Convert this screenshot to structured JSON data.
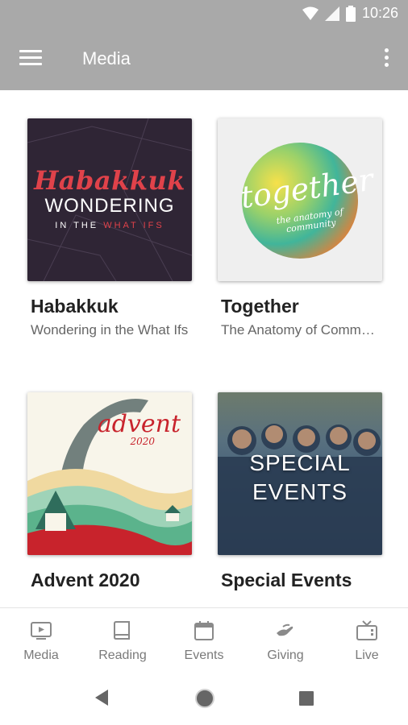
{
  "status_bar": {
    "time": "10:26",
    "icons": [
      "wifi-icon",
      "signal-icon",
      "battery-icon"
    ]
  },
  "app_bar": {
    "title": "Media",
    "menu_icon": "hamburger-menu-icon",
    "overflow_icon": "more-vert-icon"
  },
  "media_items": [
    {
      "title": "Habakkuk",
      "subtitle": "Wondering in the What Ifs",
      "artwork": {
        "script": "Habakkuk",
        "headline": "WONDERING",
        "tagline_prefix": "IN THE",
        "tagline_highlight": "WHAT IFS"
      }
    },
    {
      "title": "Together",
      "subtitle": "The Anatomy of Community",
      "artwork": {
        "script": "together",
        "tagline": "the anatomy of community"
      }
    },
    {
      "title": "Advent 2020",
      "subtitle": "",
      "artwork": {
        "script": "advent",
        "year": "2020"
      }
    },
    {
      "title": "Special Events",
      "subtitle": "",
      "artwork": {
        "line1": "SPECIAL",
        "line2": "EVENTS"
      }
    }
  ],
  "bottom_nav": [
    {
      "label": "Media",
      "icon": "media-tv-icon"
    },
    {
      "label": "Reading",
      "icon": "book-icon"
    },
    {
      "label": "Events",
      "icon": "calendar-icon"
    },
    {
      "label": "Giving",
      "icon": "giving-hand-icon"
    },
    {
      "label": "Live",
      "icon": "live-tv-icon"
    }
  ],
  "system_nav": [
    "back-icon",
    "home-icon",
    "recents-icon"
  ],
  "colors": {
    "app_bar": "#a9a9a9",
    "accent_red": "#e0424a",
    "nav_label": "#7a7a7a"
  }
}
